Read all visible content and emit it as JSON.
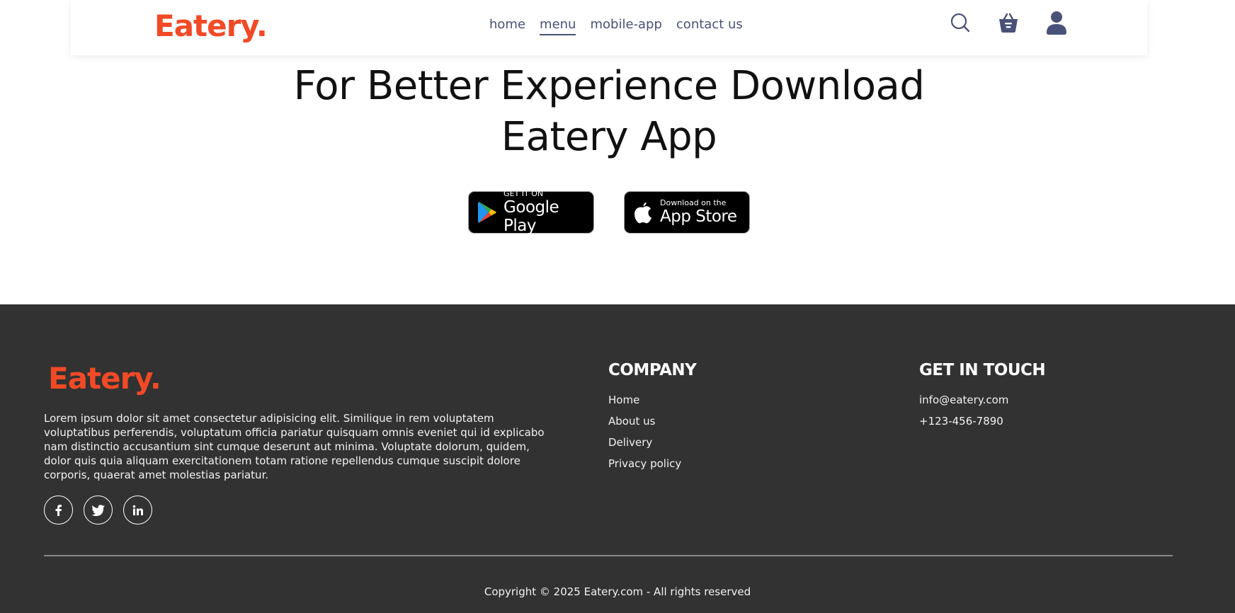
{
  "header": {
    "logo": "Eatery.",
    "nav": [
      {
        "label": "home"
      },
      {
        "label": "menu",
        "active": true
      },
      {
        "label": "mobile-app"
      },
      {
        "label": "contact us"
      }
    ],
    "icons": [
      "search-icon",
      "basket-icon",
      "user-icon"
    ]
  },
  "hero": {
    "title_line1": "For Better Experience Download",
    "title_line2": "Eatery App"
  },
  "stores": {
    "google": {
      "small": "GET IT ON",
      "big": "Google Play"
    },
    "apple": {
      "small": "Download on the",
      "big": "App Store"
    }
  },
  "footer": {
    "logo": "Eatery.",
    "description": "Lorem ipsum dolor sit amet consectetur adipisicing elit. Similique in rem voluptatem voluptatibus perferendis, voluptatum officia pariatur quisquam omnis eveniet qui id explicabo nam distinctio accusantium sint cumque deserunt aut minima. Voluptate dolorum, quidem, dolor quis quia aliquam exercitationem totam ratione repellendus cumque suscipit dolore corporis, quaerat amet molestias pariatur.",
    "social": [
      "facebook-icon",
      "twitter-icon",
      "linkedin-icon"
    ],
    "company": {
      "title": "COMPANY",
      "links": [
        "Home",
        "About us",
        "Delivery",
        "Privacy policy"
      ]
    },
    "touch": {
      "title": "GET IN TOUCH",
      "email": "info@eatery.com",
      "phone": "+123-456-7890"
    },
    "copyright": "Copyright © 2025 Eatery.com - All rights reserved"
  },
  "colors": {
    "brand": "#f24a26",
    "nav_text": "#4a5178",
    "footer_bg": "#323232"
  }
}
